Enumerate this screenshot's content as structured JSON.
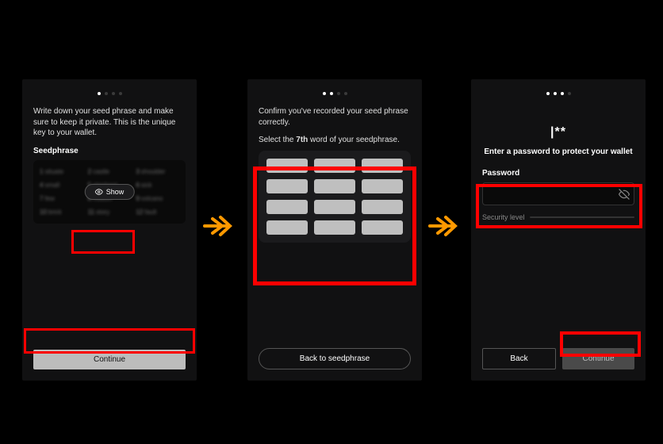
{
  "highlight_color": "#ff0000",
  "arrow_color": "#ff9900",
  "panel1": {
    "step_active": 1,
    "step_total": 4,
    "description": "Write down your seed phrase and make sure to keep it private. This is the unique key to your wallet.",
    "seed_label": "Seedphrase",
    "words": [
      {
        "n": 1,
        "w": "situate"
      },
      {
        "n": 2,
        "w": "castle"
      },
      {
        "n": 3,
        "w": "shoulder"
      },
      {
        "n": 4,
        "w": "small"
      },
      {
        "n": 5,
        "w": "elephant"
      },
      {
        "n": 6,
        "w": "sick"
      },
      {
        "n": 7,
        "w": "few"
      },
      {
        "n": 8,
        "w": "reason"
      },
      {
        "n": 9,
        "w": "volcano"
      },
      {
        "n": 10,
        "w": "brick"
      },
      {
        "n": 11,
        "w": "story"
      },
      {
        "n": 12,
        "w": "fault"
      }
    ],
    "show_label": "Show",
    "continue_label": "Continue"
  },
  "panel2": {
    "step_active": 2,
    "step_total": 4,
    "description": "Confirm you've recorded your seed phrase correctly.",
    "select_prefix": "Select the ",
    "select_nth": "7th",
    "select_suffix": " word of your seedphrase.",
    "word_count": 12,
    "back_label": "Back to seedphrase"
  },
  "panel3": {
    "step_active": 3,
    "step_total": 4,
    "password_masked": "|**",
    "title": "Enter a password to protect your wallet",
    "password_label": "Password",
    "security_label": "Security level",
    "back_label": "Back",
    "continue_label": "Continue"
  }
}
